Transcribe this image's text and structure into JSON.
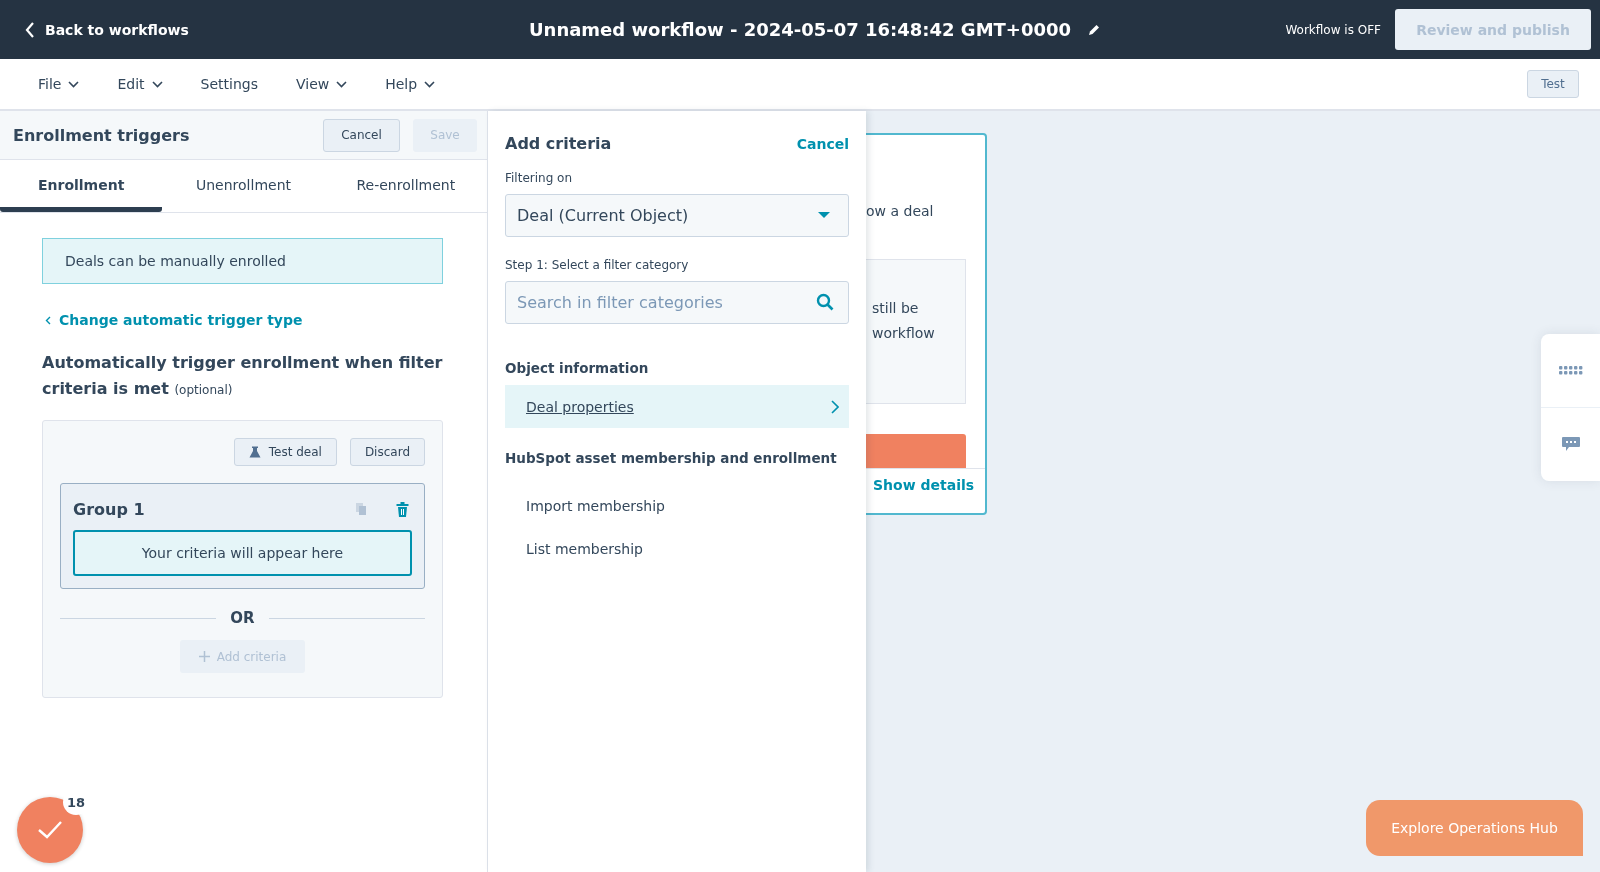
{
  "top_bar": {
    "back_link": "Back to workflows",
    "title": "Unnamed workflow - 2024-05-07 16:48:42 GMT+0000",
    "status": "Workflow is OFF",
    "publish_button": {
      "label": "Review and publish",
      "disabled": true
    }
  },
  "menu": [
    {
      "label": "File",
      "has_dropdown": true
    },
    {
      "label": "Edit",
      "has_dropdown": true
    },
    {
      "label": "Settings",
      "has_dropdown": false
    },
    {
      "label": "View",
      "has_dropdown": true
    },
    {
      "label": "Help",
      "has_dropdown": true
    }
  ],
  "test_button": "Test",
  "enrollment_panel": {
    "title": "Enrollment triggers",
    "buttons": [
      {
        "label": "Cancel",
        "disabled": false
      },
      {
        "label": "Save",
        "disabled": true
      }
    ],
    "tabs": [
      {
        "label": "Enrollment",
        "selected": true
      },
      {
        "label": "Unenrollment",
        "selected": false
      },
      {
        "label": "Re-enrollment",
        "selected": false
      }
    ],
    "notice": "Deals can be manually enrolled",
    "change_link": "Change automatic trigger type",
    "heading": "Automatically trigger enrollment when filter criteria is met",
    "heading_note": "(optional)",
    "filter_box": {
      "test_button": "Test deal",
      "discard_button": "Discard",
      "group": {
        "title": "Group 1",
        "placeholder": "Your criteria will appear here"
      },
      "separator": "OR",
      "add_button": {
        "label": "Add criteria",
        "disabled": true
      }
    }
  },
  "criteria_panel": {
    "title": "Add criteria",
    "cancel_link": "Cancel",
    "filtering_label": "Filtering on",
    "object_select": "Deal (Current Object)",
    "step_label": "Step 1: Select a filter category",
    "search": {
      "placeholder": "Search in filter categories"
    },
    "sections": [
      {
        "title": "Object information",
        "items": [
          {
            "label": "Deal properties",
            "selected": true
          }
        ]
      },
      {
        "title": "HubSpot asset membership and enrollment",
        "items": [
          {
            "label": "Import membership",
            "selected": false
          },
          {
            "label": "List membership",
            "selected": false
          }
        ]
      }
    ]
  },
  "canvas_card": {
    "text_1": "ow a deal",
    "text_2": [
      "still be",
      "workflow"
    ],
    "link": "Show details"
  },
  "tasks_badge": "18",
  "promo_button": "Explore Operations Hub"
}
